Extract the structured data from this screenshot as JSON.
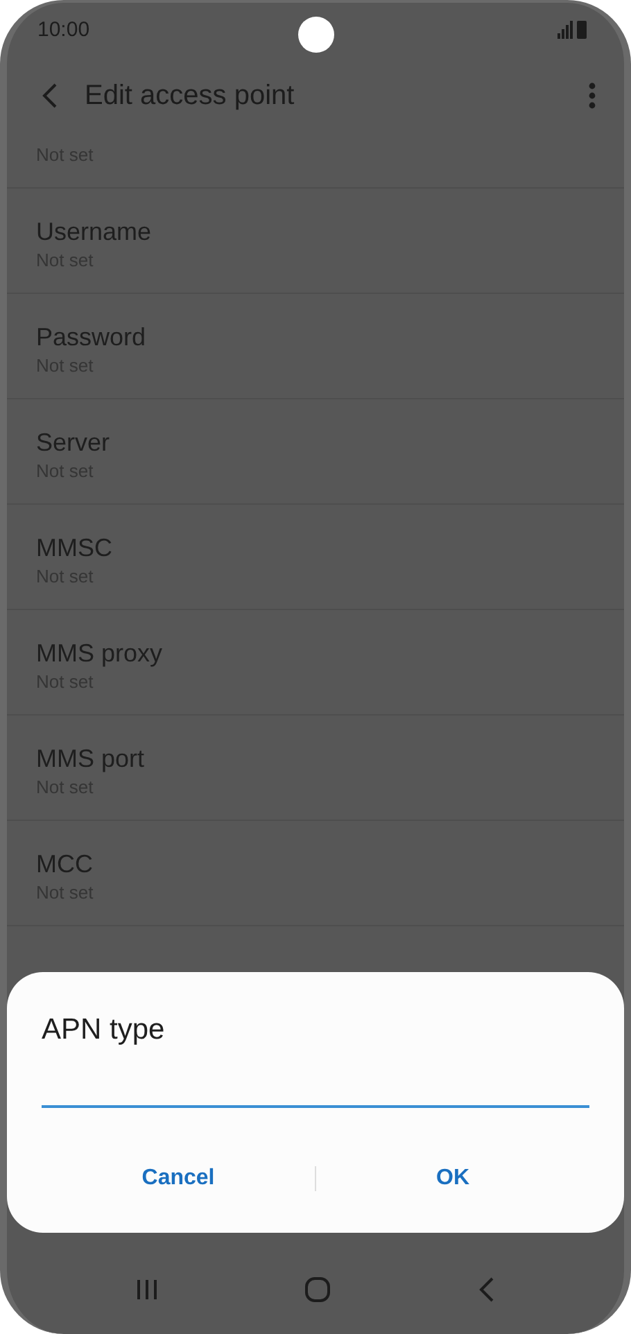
{
  "status_bar": {
    "time": "10:00"
  },
  "header": {
    "title": "Edit access point"
  },
  "settings": [
    {
      "value": "Not set"
    },
    {
      "label": "Username",
      "value": "Not set"
    },
    {
      "label": "Password",
      "value": "Not set"
    },
    {
      "label": "Server",
      "value": "Not set"
    },
    {
      "label": "MMSC",
      "value": "Not set"
    },
    {
      "label": "MMS proxy",
      "value": "Not set"
    },
    {
      "label": "MMS port",
      "value": "Not set"
    },
    {
      "label": "MCC",
      "value": "Not set"
    }
  ],
  "dialog": {
    "title": "APN type",
    "buttons": [
      "Cancel",
      "OK"
    ]
  }
}
